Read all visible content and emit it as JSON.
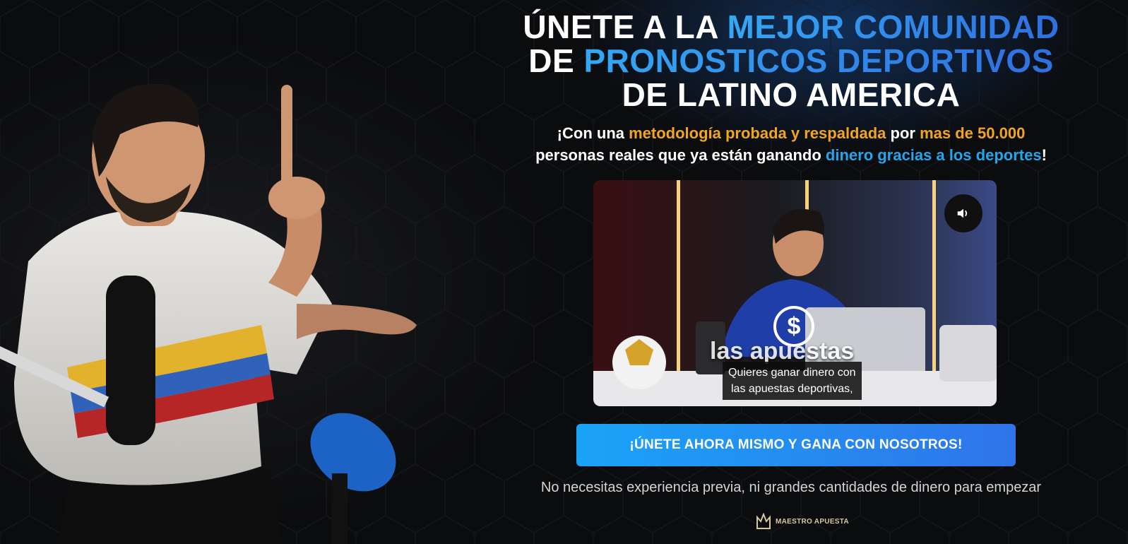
{
  "headline": {
    "line1_white": "ÚNETE A LA ",
    "line1_blue": "MEJOR COMUNIDAD",
    "line2_white": "DE ",
    "line2_blue": "PRONOSTICOS DEPORTIVOS",
    "line3_white": "DE LATINO AMERICA"
  },
  "subheadline": {
    "part1": "¡Con una ",
    "highlight1": "metodología probada y respaldada",
    "part2": " por ",
    "highlight2": "mas de 50.000",
    "part3": "personas reales que ya están ganando ",
    "highlight3": "dinero gracias a los deportes",
    "part4": "!"
  },
  "video": {
    "mute_icon": "speaker-icon",
    "caption_overlay": "las apuestas",
    "caption_line1": "Quieres ganar dinero con",
    "caption_line2": "las apuestas deportivas,"
  },
  "cta": {
    "label": "¡ÚNETE AHORA MISMO Y GANA CON NOSOTROS!"
  },
  "note": "No necesitas experiencia previa, ni grandes cantidades de dinero para empezar",
  "logo": {
    "text": "MAESTRO APUESTA"
  },
  "colors": {
    "accent_blue": "#2f8bef",
    "accent_gold": "#f2a51e",
    "accent_cyan": "#23a6ee",
    "background": "#0b0c0e"
  }
}
